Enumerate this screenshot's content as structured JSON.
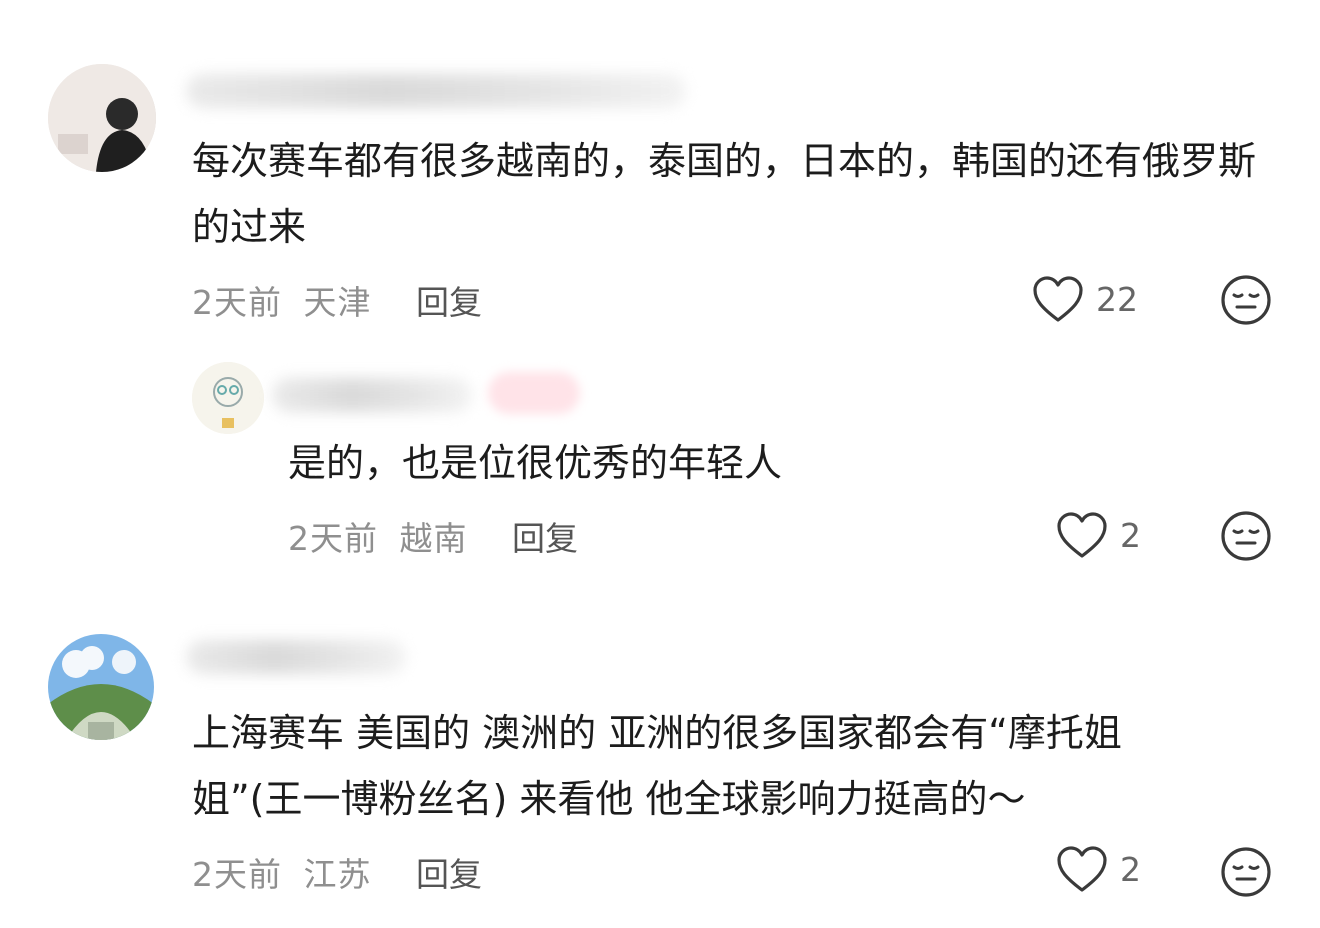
{
  "comments": [
    {
      "text": "每次赛车都有很多越南的，泰国的，日本的，韩国的还有俄罗斯的过来",
      "time": "2天前",
      "location": "天津",
      "reply_label": "回复",
      "likes": "22",
      "replies": [
        {
          "text": "是的，也是位很优秀的年轻人",
          "time": "2天前",
          "location": "越南",
          "reply_label": "回复",
          "likes": "2"
        }
      ]
    },
    {
      "text": "上海赛车 美国的 澳洲的 亚洲的很多国家都会有“摩托姐姐”(王一博粉丝名) 来看他 他全球影响力挺高的～",
      "time": "2天前",
      "location": "江苏",
      "reply_label": "回复",
      "likes": "2"
    }
  ],
  "icons": {
    "like": "heart-outline-icon",
    "dislike": "neutral-face-icon"
  },
  "colors": {
    "meta_text": "#8f8f8f",
    "badge": "#ff5a7a"
  }
}
